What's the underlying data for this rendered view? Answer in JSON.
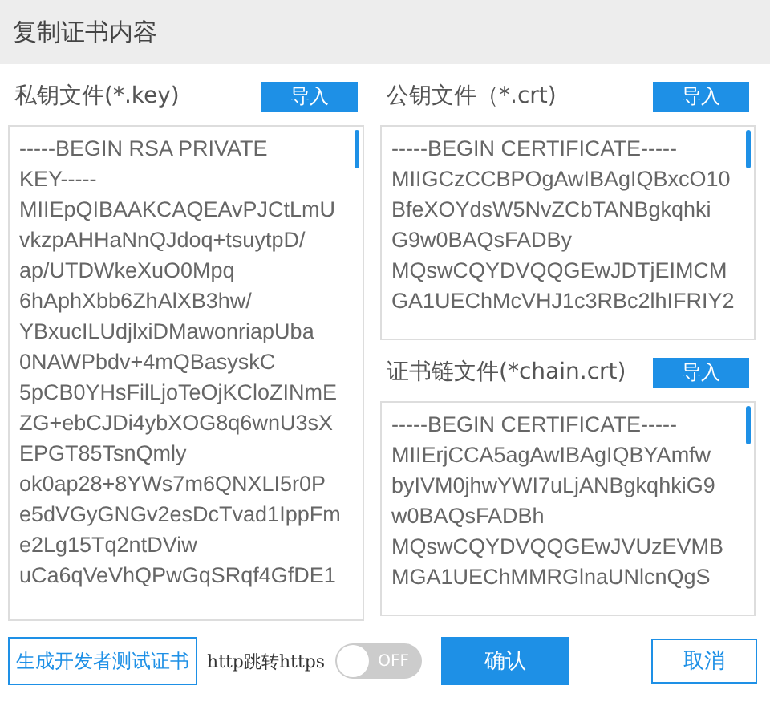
{
  "window": {
    "title": "复制证书内容"
  },
  "private_key": {
    "label": "私钥文件(*.key)",
    "import_button": "导入",
    "lines": [
      "-----BEGIN RSA PRIVATE",
      "KEY-----",
      "MIIEpQIBAAKCAQEAvPJCtLmU",
      "vkzpAHHaNnQJdoq+tsuytpD/",
      "ap/UTDWkeXuO0Mpq",
      "6hAphXbb6ZhAlXB3hw/",
      "YBxucILUdjlxiDMawonriapUba",
      "0NAWPbdv+4mQBasyskC",
      "5pCB0YHsFilLjoTeOjKCloZINmE",
      "ZG+ebCJDi4ybXOG8q6wnU3sX",
      "EPGT85TsnQmly",
      "ok0ap28+8YWs7m6QNXLI5r0P",
      "e5dVGyGNGv2esDcTvad1IppFm",
      "e2Lg15Tq2ntDViw",
      "uCa6qVeVhQPwGqSRqf4GfDE1"
    ]
  },
  "public_key": {
    "label": "公钥文件（*.crt)",
    "import_button": "导入",
    "lines": [
      "-----BEGIN CERTIFICATE-----",
      "MIIGCzCCBPOgAwIBAgIQBxcO10",
      "BfeXOYdsW5NvZCbTANBgkqhki",
      "G9w0BAQsFADBy",
      "MQswCQYDVQQGEwJDTjEIMCM",
      "GA1UEChMcVHJ1c3RBc2lhIFRIY2"
    ]
  },
  "chain": {
    "label": "证书链文件(*chain.crt)",
    "import_button": "导入",
    "lines": [
      "-----BEGIN CERTIFICATE-----",
      "MIIErjCCA5agAwIBAgIQBYAmfw",
      "byIVM0jhwYWI7uLjANBgkqhkiG9",
      "w0BAQsFADBh",
      "MQswCQYDVQQGEwJVUzEVMB",
      "MGA1UEChMMRGlnaUNlcnQgS"
    ]
  },
  "footer": {
    "generate_button": "生成开发者测试证书",
    "redirect_label": "http跳转https",
    "toggle": {
      "label": "OFF",
      "on": false
    },
    "confirm_button": "确认",
    "cancel_button": "取消"
  }
}
